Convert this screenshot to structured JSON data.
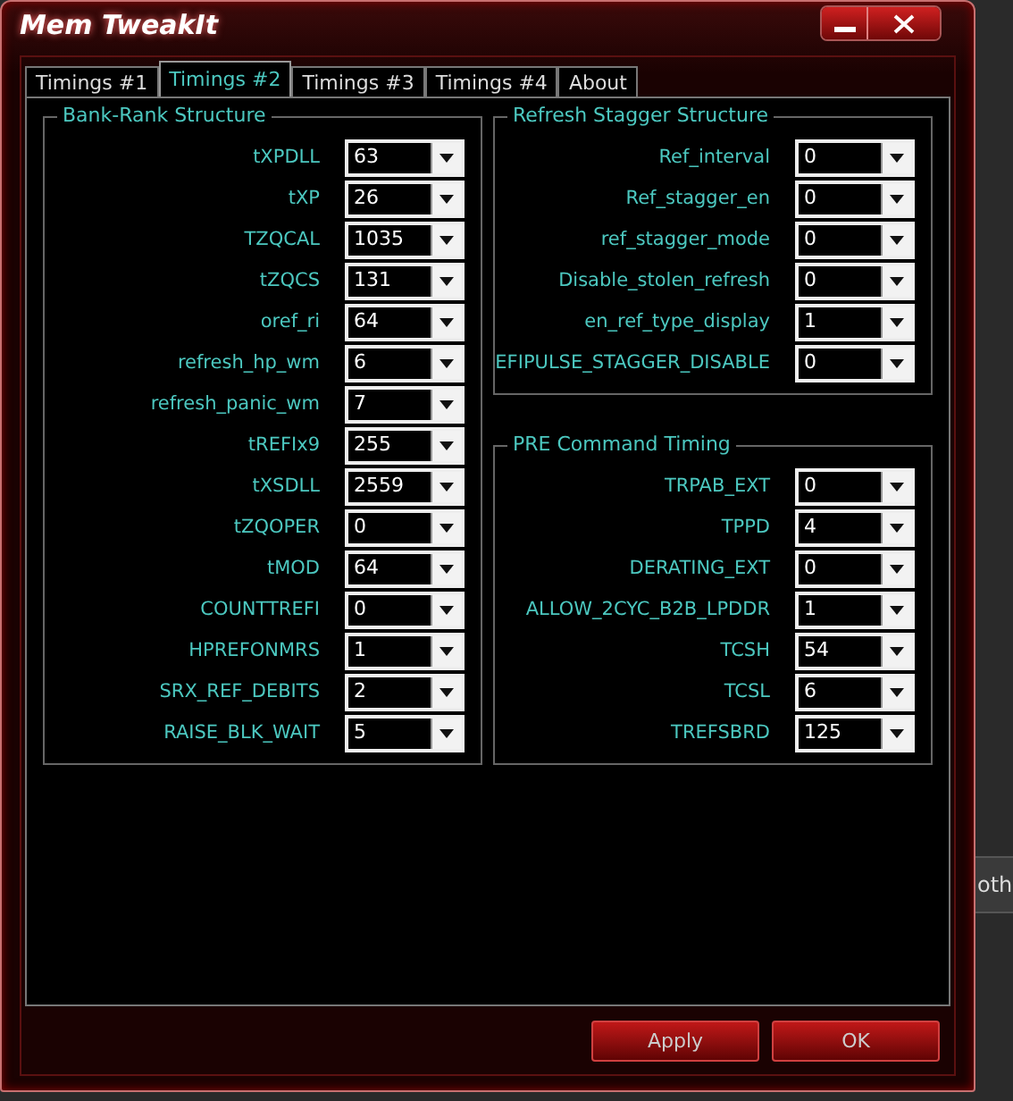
{
  "window": {
    "title": "Mem TweakIt"
  },
  "tabs": [
    {
      "label": "Timings #1",
      "selected": false
    },
    {
      "label": "Timings #2",
      "selected": true
    },
    {
      "label": "Timings #3",
      "selected": false
    },
    {
      "label": "Timings #4",
      "selected": false
    },
    {
      "label": "About",
      "selected": false
    }
  ],
  "groups": [
    {
      "title": "Bank-Rank Structure",
      "fields": [
        {
          "label": "tXPDLL",
          "value": "63"
        },
        {
          "label": "tXP",
          "value": "26"
        },
        {
          "label": "TZQCAL",
          "value": "1035"
        },
        {
          "label": "tZQCS",
          "value": "131"
        },
        {
          "label": "oref_ri",
          "value": "64"
        },
        {
          "label": "refresh_hp_wm",
          "value": "6"
        },
        {
          "label": "refresh_panic_wm",
          "value": "7"
        },
        {
          "label": "tREFIx9",
          "value": "255"
        },
        {
          "label": "tXSDLL",
          "value": "2559"
        },
        {
          "label": "tZQOPER",
          "value": "0"
        },
        {
          "label": "tMOD",
          "value": "64"
        },
        {
          "label": "COUNTTREFI",
          "value": "0"
        },
        {
          "label": "HPREFONMRS",
          "value": "1"
        },
        {
          "label": "SRX_REF_DEBITS",
          "value": "2"
        },
        {
          "label": "RAISE_BLK_WAIT",
          "value": "5"
        }
      ]
    },
    {
      "title": "Refresh Stagger Structure",
      "fields": [
        {
          "label": "Ref_interval",
          "value": "0"
        },
        {
          "label": "Ref_stagger_en",
          "value": "0"
        },
        {
          "label": "ref_stagger_mode",
          "value": "0"
        },
        {
          "label": "Disable_stolen_refresh",
          "value": "0"
        },
        {
          "label": "en_ref_type_display",
          "value": "1"
        },
        {
          "label": "EFIPULSE_STAGGER_DISABLE",
          "value": "0"
        }
      ]
    },
    {
      "title": "PRE Command Timing",
      "fields": [
        {
          "label": "TRPAB_EXT",
          "value": "0"
        },
        {
          "label": "TPPD",
          "value": "4"
        },
        {
          "label": "DERATING_EXT",
          "value": "0"
        },
        {
          "label": "ALLOW_2CYC_B2B_LPDDR",
          "value": "1"
        },
        {
          "label": "TCSH",
          "value": "54"
        },
        {
          "label": "TCSL",
          "value": "6"
        },
        {
          "label": "TREFSBRD",
          "value": "125"
        }
      ]
    }
  ],
  "buttons": [
    "Apply",
    "OK"
  ],
  "background_text": "oth"
}
